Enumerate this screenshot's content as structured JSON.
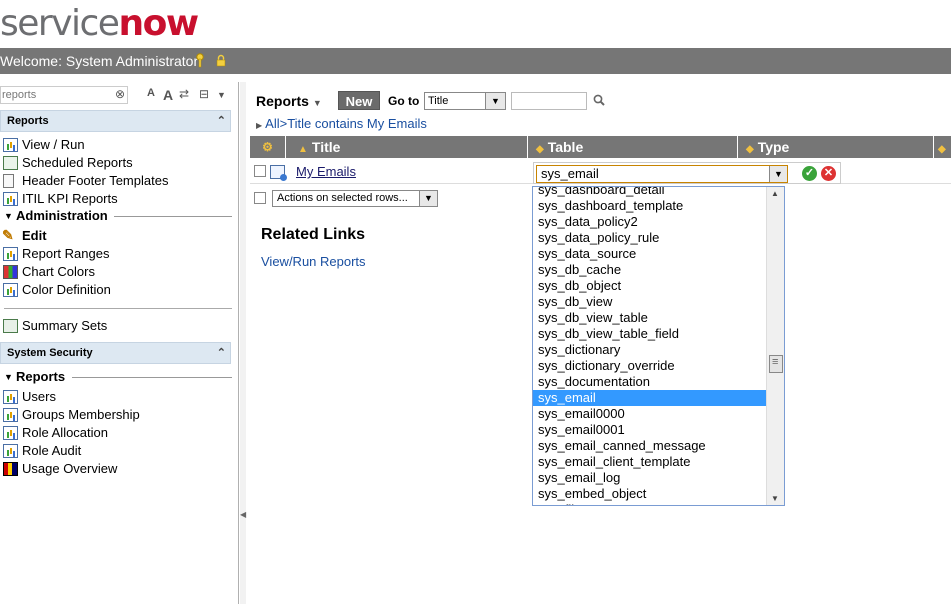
{
  "header": {
    "logo_service": "service",
    "logo_now": "now",
    "welcome": "Welcome: System Administrator"
  },
  "nav": {
    "filter_value": "reports",
    "section_reports": "Reports",
    "reports_items": [
      {
        "label": "View / Run",
        "icon": "report-chart-icon"
      },
      {
        "label": "Scheduled Reports",
        "icon": "schedule-icon"
      },
      {
        "label": "Header Footer Templates",
        "icon": "document-icon"
      },
      {
        "label": "ITIL KPI Reports",
        "icon": "report-chart-icon"
      }
    ],
    "group_administration": "Administration",
    "admin_items": [
      {
        "label": "Edit",
        "icon": "pencil-icon"
      },
      {
        "label": "Report Ranges",
        "icon": "report-chart-icon"
      },
      {
        "label": "Chart Colors",
        "icon": "color-bars-icon"
      },
      {
        "label": "Color Definition",
        "icon": "report-chart-icon"
      }
    ],
    "summary_sets": "Summary Sets",
    "section_security": "System Security",
    "group_reports": "Reports",
    "security_items": [
      {
        "label": "Users",
        "icon": "report-chart-icon"
      },
      {
        "label": "Groups Membership",
        "icon": "report-chart-icon"
      },
      {
        "label": "Role Allocation",
        "icon": "report-chart-icon"
      },
      {
        "label": "Role Audit",
        "icon": "report-chart-icon"
      },
      {
        "label": "Usage Overview",
        "icon": "usage-bars-icon"
      }
    ]
  },
  "toolbar": {
    "reports_label": "Reports",
    "new_label": "New",
    "goto_label": "Go to",
    "goto_field": "Title",
    "search_value": ""
  },
  "breadcrumb": {
    "all": "All",
    "sep": ">",
    "filter": "Title contains My Emails"
  },
  "grid": {
    "columns": [
      "Title",
      "Table",
      "Type"
    ],
    "rows": [
      {
        "title": "My Emails",
        "table": "sys_email"
      }
    ],
    "actions_label": "Actions on selected rows..."
  },
  "related": {
    "title": "Related Links",
    "link": "View/Run Reports"
  },
  "dropdown": {
    "selected": "sys_email",
    "options": [
      "sys_dashboard_detail",
      "sys_dashboard_template",
      "sys_data_policy2",
      "sys_data_policy_rule",
      "sys_data_source",
      "sys_db_cache",
      "sys_db_object",
      "sys_db_view",
      "sys_db_view_table",
      "sys_db_view_table_field",
      "sys_dictionary",
      "sys_dictionary_override",
      "sys_documentation",
      "sys_email",
      "sys_email0000",
      "sys_email0001",
      "sys_email_canned_message",
      "sys_email_client_template",
      "sys_email_log",
      "sys_embed_object",
      "sys_filter"
    ]
  },
  "colors": {
    "header_bar": "#767676",
    "logo_accent": "#c8102e",
    "selection": "#3399ff",
    "link": "#1a4fa0"
  }
}
